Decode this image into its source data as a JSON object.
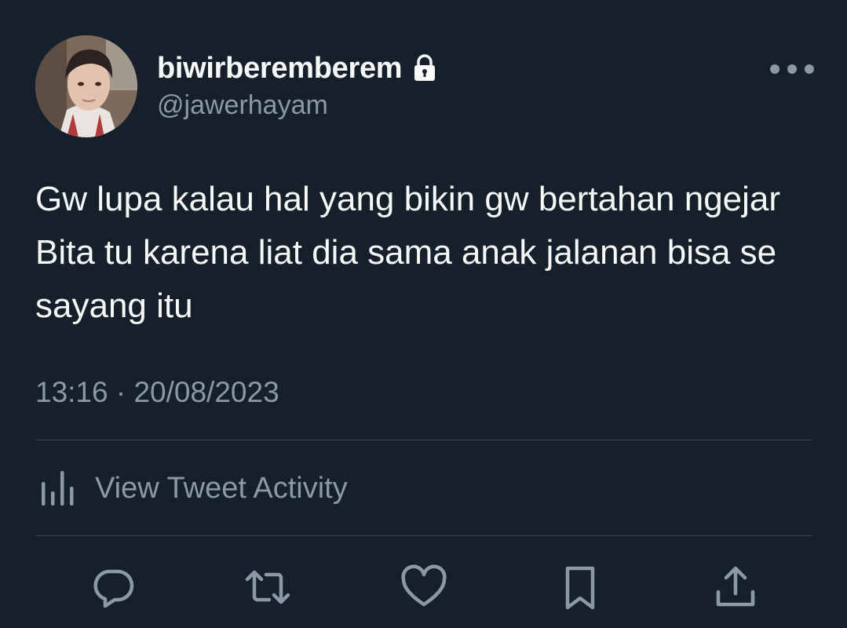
{
  "user": {
    "display_name": "biwirberemberem",
    "handle": "@jawerhayam",
    "protected_icon": "lock-icon",
    "avatar_icon": "profile-photo"
  },
  "tweet": {
    "text": "Gw lupa kalau hal yang bikin gw bertahan ngejar Bita tu karena liat dia sama anak jalanan bisa se sayang itu",
    "timestamp": "13:16 · 20/08/2023"
  },
  "activity": {
    "label": "View Tweet Activity",
    "icon": "bar-chart-icon"
  },
  "actions": [
    "reply-icon",
    "retweet-icon",
    "like-icon",
    "bookmark-icon",
    "share-icon"
  ],
  "colors": {
    "background": "#15202b",
    "text_primary": "#f7f9f9",
    "text_secondary": "#8b98a5",
    "divider": "#38444d"
  }
}
